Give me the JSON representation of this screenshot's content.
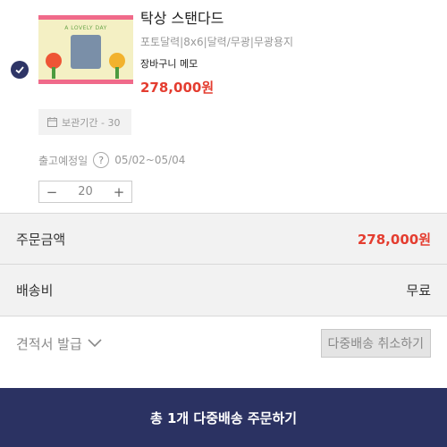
{
  "item": {
    "checked": true,
    "thumbnail_text": "A LOVELY DAY",
    "title": "탁상 스탠다드",
    "options": "포토달력|8x6|달력/무광|무광용지",
    "memo": "장바구니 메모",
    "price": "278,000원",
    "storage_period": "보관기간 - 30",
    "ship_label": "출고예정일",
    "ship_dates": "05/02~05/04",
    "quantity": "20",
    "minus": "−",
    "plus": "+"
  },
  "summary": {
    "total_label": "주문금액",
    "total_value": "278,000원",
    "delivery_label": "배송비",
    "delivery_value": "무료"
  },
  "quote": {
    "label": "견적서 발급",
    "cancel_button": "다중배송 취소하기"
  },
  "order_button": "총 1개 다중배송 주문하기",
  "colors": {
    "accent_navy": "#2b3262",
    "price_red": "#e43d30"
  },
  "icons": [
    "check-icon",
    "calendar-icon",
    "question-icon",
    "chevron-down-icon"
  ]
}
